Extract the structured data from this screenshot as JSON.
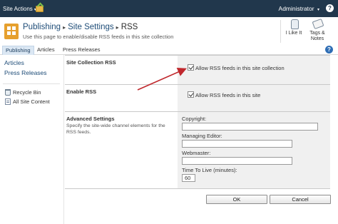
{
  "topbar": {
    "site_actions": "Site Actions",
    "admin": "Administrator",
    "caret": "▾",
    "help_icon": "?"
  },
  "header": {
    "breadcrumb": [
      "Publishing",
      "Site Settings",
      "RSS"
    ],
    "separator": "▸",
    "description": "Use this page to enable/disable RSS feeds in this site collection",
    "tools": [
      {
        "label": "I Like It",
        "icon": "thumbs-up-icon"
      },
      {
        "label": "Tags & Notes",
        "icon": "tag-icon"
      }
    ]
  },
  "tabs": [
    {
      "label": "Publishing",
      "selected": true
    },
    {
      "label": "Articles",
      "selected": false
    },
    {
      "label": "Press Releases",
      "selected": false
    }
  ],
  "quicklaunch": {
    "links": [
      "Articles",
      "Press Releases"
    ],
    "utilities": [
      {
        "label": "Recycle Bin",
        "icon": "recycle-bin-icon"
      },
      {
        "label": "All Site Content",
        "icon": "site-content-icon"
      }
    ]
  },
  "sections": {
    "collection": {
      "title": "Site Collection RSS",
      "checkbox_label": "Allow RSS feeds in this site collection",
      "checked": true
    },
    "enable": {
      "title": "Enable RSS",
      "checkbox_label": "Allow RSS feeds in this site",
      "checked": true
    },
    "advanced": {
      "title": "Advanced Settings",
      "description": "Specify the site-wide channel elements for the RSS feeds.",
      "fields": [
        {
          "label": "Copyright:",
          "value": ""
        },
        {
          "label": "Managing Editor:",
          "value": ""
        },
        {
          "label": "Webmaster:",
          "value": ""
        },
        {
          "label": "Time To Live (minutes):",
          "value": "60"
        }
      ]
    }
  },
  "buttons": {
    "ok": "OK",
    "cancel": "Cancel"
  },
  "colors": {
    "topbar": "#21374c",
    "link": "#1f4d78",
    "arrow": "#c0282d",
    "selected_tab": "#dbe7f3"
  }
}
